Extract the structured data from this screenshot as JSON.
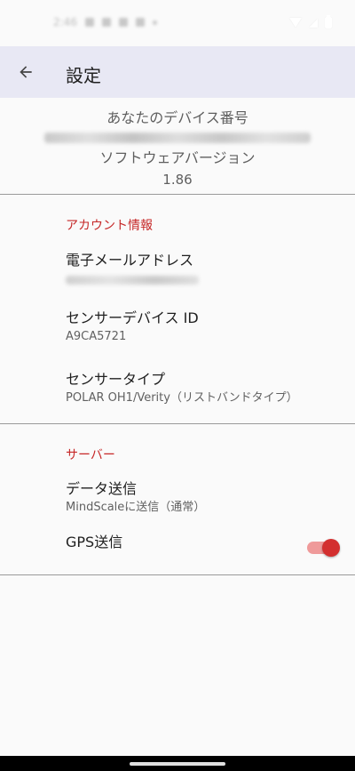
{
  "status_bar": {
    "time": "2:46",
    "icons": [
      "gallery-icon",
      "notification-icon",
      "alert-icon",
      "download-icon"
    ],
    "right_icons": [
      "wifi-icon",
      "signal-icon",
      "battery-icon"
    ]
  },
  "app_bar": {
    "title": "設定",
    "back_icon": "arrow-back-icon"
  },
  "device": {
    "id_label": "あなたのデバイス番号",
    "software_label": "ソフトウェアバージョン",
    "version": "1.86"
  },
  "account": {
    "header": "アカウント情報",
    "email_title": "電子メールアドレス",
    "sensor_id_title": "センサーデバイス ID",
    "sensor_id_value": "A9CA5721",
    "sensor_type_title": "センサータイプ",
    "sensor_type_value": "POLAR OH1/Verity（リストバンドタイプ）"
  },
  "server": {
    "header": "サーバー",
    "data_send_title": "データ送信",
    "data_send_value": "MindScaleに送信（通常）",
    "gps_title": "GPS送信",
    "gps_enabled": true
  },
  "colors": {
    "accent": "#c62828",
    "app_bar_bg": "#e8e8f4",
    "toggle_thumb": "#d32f2f",
    "toggle_track": "#ef9a9a"
  }
}
